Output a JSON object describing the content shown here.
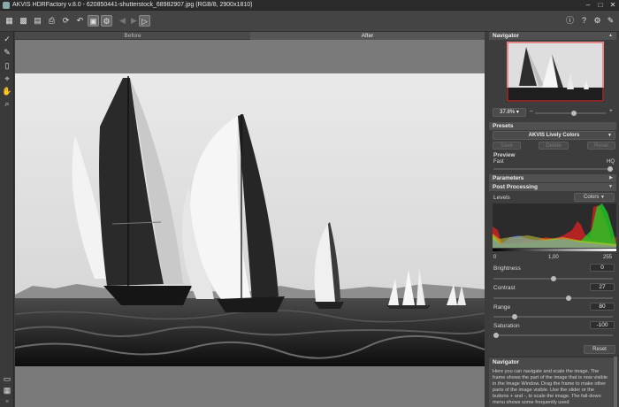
{
  "title": "AKVIS HDRFactory v.8.0 - 620850441-shutterstock_68982907.jpg (RGB/8, 2900x1810)",
  "window_controls": [
    "–",
    "□",
    "✕"
  ],
  "toolbar": {
    "left_icons": [
      "open-icon",
      "save-icon",
      "save-as-icon",
      "print-icon",
      "batch-icon",
      "undo-icon",
      "redo-icon",
      "compare-icon",
      "settings-toggle-icon",
      "back-icon",
      "forward-icon",
      "run-icon"
    ],
    "right_icons": [
      "info-icon",
      "help-icon",
      "settings-icon",
      "notification-icon"
    ]
  },
  "view_tabs": {
    "before": "Before",
    "after": "After"
  },
  "navigator": {
    "header": "Navigator",
    "zoom": "37.8%",
    "zoom_level": 0.55
  },
  "presets": {
    "header": "Presets",
    "selected": "AKVIS Lively Colors",
    "save": "Save",
    "delete": "Delete",
    "reset": "Reset"
  },
  "preview": {
    "label": "Preview",
    "fast": "Fast",
    "hq": "HQ",
    "level": 1.0
  },
  "parameters": {
    "header": "Parameters"
  },
  "post_processing": {
    "header": "Post Processing",
    "levels_label": "Levels",
    "levels_mode": "Colors",
    "level_min": "0",
    "level_mid": "1,00",
    "level_max": "255",
    "brightness": {
      "label": "Brightness",
      "value": "0",
      "level": 0.5
    },
    "contrast": {
      "label": "Contrast",
      "value": "27",
      "level": 0.635
    },
    "range": {
      "label": "Range",
      "value": "80",
      "level": 0.16
    },
    "saturation": {
      "label": "Saturation",
      "value": "-100",
      "level": 0.0
    },
    "reset": "Reset"
  },
  "help": {
    "header": "Navigator",
    "text": "Here you can navigate and scale the image. The frame shows the part of the image that is now visible in the Image Window. Drag the frame to make other parts of the image visible. Use the slider or the buttons + and -, to scale the image. The fall-down menu shows some frequently used"
  },
  "colors": {
    "accent": "#4a90d9",
    "panel": "#3d3d3d",
    "section": "#505050"
  }
}
